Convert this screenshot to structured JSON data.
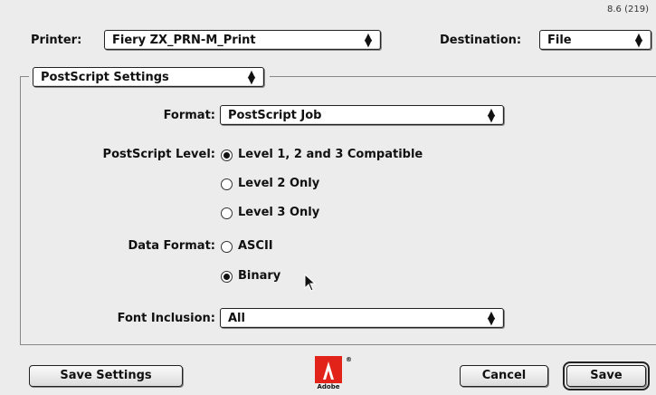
{
  "version": "8.6 (219)",
  "printer": {
    "label": "Printer:",
    "value": "Fiery ZX_PRN-M_Print"
  },
  "destination": {
    "label": "Destination:",
    "value": "File"
  },
  "section": {
    "value": "PostScript Settings"
  },
  "format": {
    "label": "Format:",
    "value": "PostScript Job"
  },
  "postscript_level": {
    "label": "PostScript Level:",
    "options": [
      "Level 1, 2 and 3 Compatible",
      "Level 2 Only",
      "Level 3 Only"
    ],
    "selected": 0
  },
  "data_format": {
    "label": "Data Format:",
    "options": [
      "ASCII",
      "Binary"
    ],
    "selected": 1
  },
  "font_inclusion": {
    "label": "Font Inclusion:",
    "value": "All"
  },
  "buttons": {
    "save_settings": "Save Settings",
    "cancel": "Cancel",
    "save": "Save"
  },
  "logo": {
    "text": "Adobe",
    "color": "#e2231a"
  }
}
